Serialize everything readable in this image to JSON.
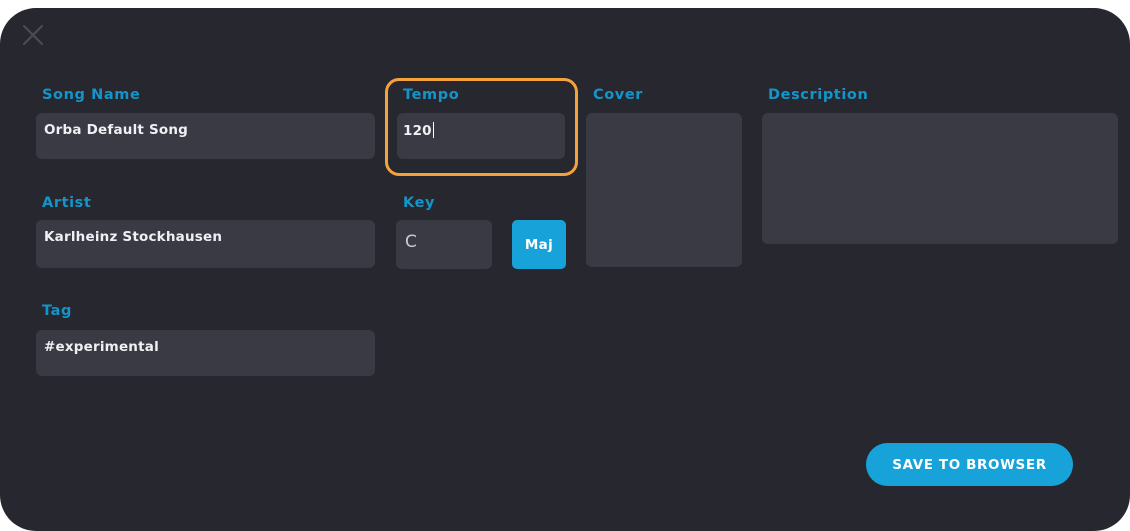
{
  "dialog": {
    "close_icon": "close-icon",
    "accent_color": "#17a3d9",
    "label_color": "#1495c9",
    "highlight_color": "#f5a23a",
    "background_color": "#26272f",
    "field_color": "#393a44"
  },
  "fields": {
    "song_name": {
      "label": "Song Name",
      "value": "Orba Default Song"
    },
    "artist": {
      "label": "Artist",
      "value": "Karlheinz Stockhausen"
    },
    "tag": {
      "label": "Tag",
      "value": "#experimental"
    },
    "tempo": {
      "label": "Tempo",
      "value": "120"
    },
    "key": {
      "label": "Key",
      "value": "C",
      "mode_button": "Maj"
    },
    "cover": {
      "label": "Cover"
    },
    "description": {
      "label": "Description",
      "value": ""
    }
  },
  "actions": {
    "save_label": "SAVE TO BROWSER"
  }
}
